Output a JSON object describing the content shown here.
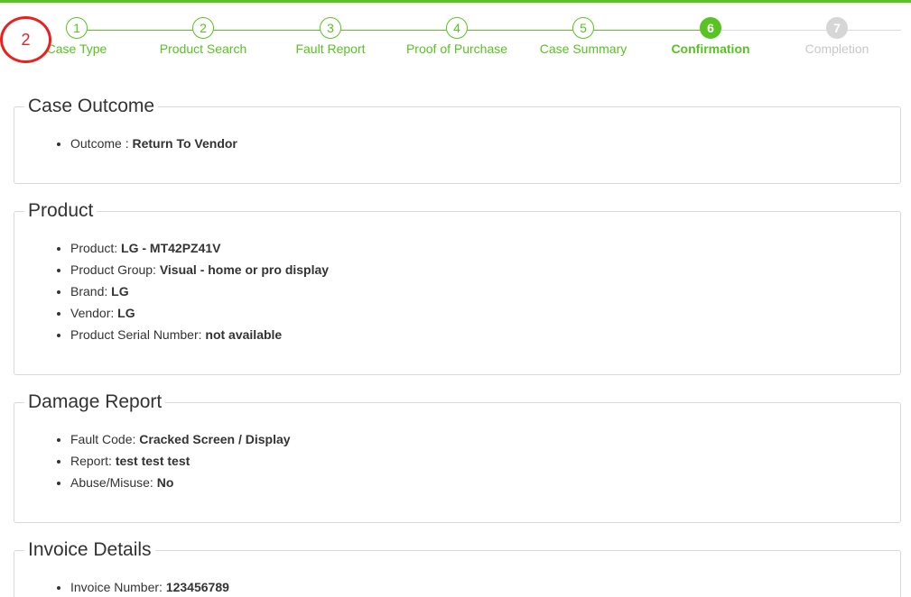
{
  "annotation": {
    "number": "2",
    "color": "#e8231f"
  },
  "colors": {
    "accent": "#58c322",
    "inactive": "#d6d6d6"
  },
  "wizard": {
    "steps": [
      {
        "number": "1",
        "label": "Case Type",
        "state": "done"
      },
      {
        "number": "2",
        "label": "Product Search",
        "state": "done"
      },
      {
        "number": "3",
        "label": "Fault Report",
        "state": "done"
      },
      {
        "number": "4",
        "label": "Proof of Purchase",
        "state": "done"
      },
      {
        "number": "5",
        "label": "Case Summary",
        "state": "done"
      },
      {
        "number": "6",
        "label": "Confirmation",
        "state": "active"
      },
      {
        "number": "7",
        "label": "Completion",
        "state": "inactive"
      }
    ]
  },
  "case_outcome": {
    "title": "Case Outcome",
    "items": [
      {
        "label": "Outcome : ",
        "value": "Return To Vendor"
      }
    ]
  },
  "product": {
    "title": "Product",
    "items": [
      {
        "label": "Product: ",
        "value": "LG - MT42PZ41V"
      },
      {
        "label": "Product Group: ",
        "value": "Visual - home or pro display"
      },
      {
        "label": "Brand: ",
        "value": "LG"
      },
      {
        "label": "Vendor: ",
        "value": "LG"
      },
      {
        "label": "Product Serial Number: ",
        "value": "not available"
      }
    ]
  },
  "damage_report": {
    "title": "Damage Report",
    "items": [
      {
        "label": "Fault Code: ",
        "value": "Cracked Screen / Display"
      },
      {
        "label": "Report: ",
        "value": "test test test"
      },
      {
        "label": "Abuse/Misuse: ",
        "value": "No"
      }
    ]
  },
  "invoice_details": {
    "title": "Invoice Details",
    "items": [
      {
        "label": "Invoice Number: ",
        "value": "123456789"
      }
    ]
  }
}
